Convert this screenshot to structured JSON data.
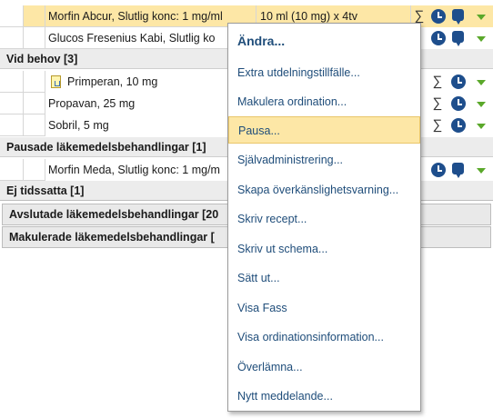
{
  "rows_top": [
    {
      "name": "Morfin Abcur, Slutlig konc: 1 mg/ml",
      "dose": "10 ml  (10 mg) x 4tv",
      "selected": true
    },
    {
      "name": "Glucos Fresenius Kabi, Slutlig ko",
      "dose": ""
    }
  ],
  "section_vid_behov": "Vid behov [3]",
  "rows_vid_behov": [
    {
      "name": "Primperan, 10 mg"
    },
    {
      "name": "Propavan, 25 mg"
    },
    {
      "name": "Sobril, 5 mg"
    }
  ],
  "section_pausade": "Pausade läkemedelsbehandlingar [1]",
  "rows_pausade": [
    {
      "name": "Morfin Meda, Slutlig konc: 1 mg/m"
    }
  ],
  "section_ej_tidssatta": "Ej tidssatta [1]",
  "section_avslutade": "Avslutade läkemedelsbehandlingar [20",
  "section_makulerade": "Makulerade läkemedelsbehandlingar [",
  "sigma_symbol": "∑",
  "context_menu": {
    "items": [
      "Ändra...",
      "Extra utdelningstillfälle...",
      "Makulera ordination...",
      "Pausa...",
      "Självadministrering...",
      "Skapa överkänslighetsvarning...",
      "Skriv recept...",
      "Skriv ut schema...",
      "Sätt ut...",
      "Visa Fass",
      "Visa ordinationsinformation...",
      "Överlämna...",
      "Nytt meddelande..."
    ],
    "highlighted_item": "Pausa..."
  },
  "colors": {
    "selected_row": "#fde7a6",
    "menu_text": "#1f4d7a",
    "icon_blue": "#1e4e8c",
    "arrow_green": "#5aa82a"
  },
  "icons": [
    "sigma-icon",
    "clock-icon",
    "speech-bubble-icon",
    "dropdown-arrow-icon",
    "document-icon"
  ]
}
